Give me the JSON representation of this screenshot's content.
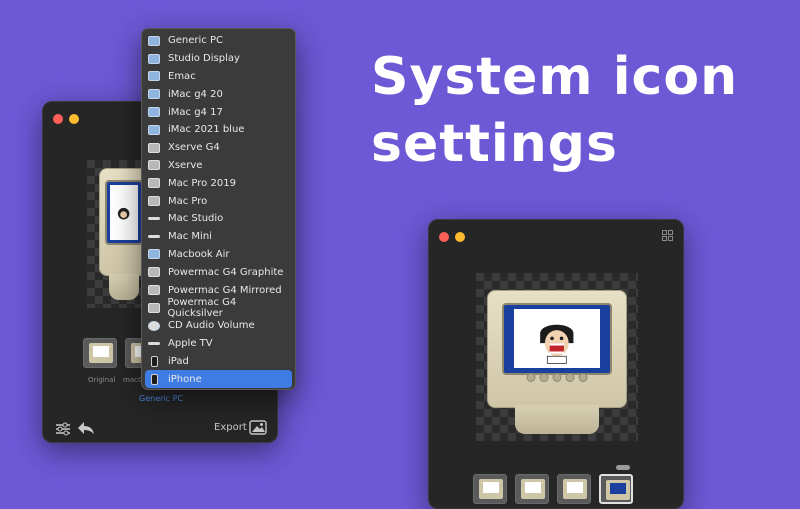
{
  "headline": {
    "line1": "System icon",
    "line2": "settings"
  },
  "colors": {
    "background": "#6d58d6",
    "accent": "#3e7ce4",
    "window": "#262626"
  },
  "menu": {
    "items": [
      {
        "label": "Generic PC",
        "icon": "monitor-icon"
      },
      {
        "label": "Studio Display",
        "icon": "monitor-icon"
      },
      {
        "label": "Emac",
        "icon": "monitor-icon"
      },
      {
        "label": "iMac g4 20",
        "icon": "monitor-icon"
      },
      {
        "label": "iMac g4 17",
        "icon": "monitor-icon"
      },
      {
        "label": "iMac 2021 blue",
        "icon": "monitor-icon"
      },
      {
        "label": "Xserve G4",
        "icon": "server-icon"
      },
      {
        "label": "Xserve",
        "icon": "server-icon"
      },
      {
        "label": "Mac Pro 2019",
        "icon": "tower-icon"
      },
      {
        "label": "Mac Pro",
        "icon": "tower-icon"
      },
      {
        "label": "Mac Studio",
        "icon": "box-icon"
      },
      {
        "label": "Mac Mini",
        "icon": "box-icon"
      },
      {
        "label": "Macbook Air",
        "icon": "laptop-icon"
      },
      {
        "label": "Powermac G4 Graphite",
        "icon": "tower-icon"
      },
      {
        "label": "Powermac G4 Mirrored",
        "icon": "tower-icon"
      },
      {
        "label": "Powermac G4 Quicksilver",
        "icon": "tower-icon"
      },
      {
        "label": "CD Audio Volume",
        "icon": "disc-icon"
      },
      {
        "label": "Apple TV",
        "icon": "box-icon"
      },
      {
        "label": "iPad",
        "icon": "tablet-icon"
      },
      {
        "label": "iPhone",
        "icon": "phone-icon",
        "selected": true
      }
    ]
  },
  "left_window": {
    "thumb_labels": [
      "Original",
      "macO"
    ],
    "selected_preset": "Generic PC",
    "export_label": "Export"
  }
}
